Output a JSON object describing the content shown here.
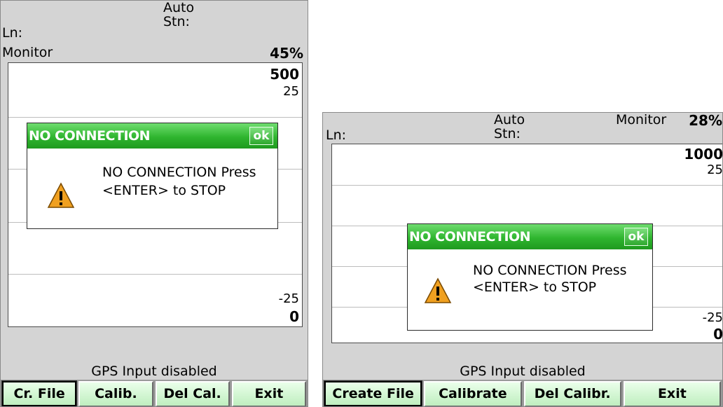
{
  "left_screen": {
    "header": {
      "mode": "Auto",
      "ln_label": "Ln:",
      "stn_label": "Stn:",
      "monitor_label": "Monitor",
      "percent": "45%"
    },
    "plot": {
      "top_scale": "500",
      "top_sub": "25",
      "bottom_sub": "-25",
      "bottom_scale": "0"
    },
    "dialog": {
      "title": "NO CONNECTION",
      "ok_label": "ok",
      "message_line1": "NO CONNECTION Press",
      "message_line2": "<ENTER> to STOP"
    },
    "status": "GPS  Input  disabled",
    "softkeys": [
      "Cr. File",
      "Calib.",
      "Del Cal.",
      "Exit"
    ]
  },
  "right_screen": {
    "header": {
      "mode": "Auto",
      "ln_label": "Ln:",
      "stn_label": "Stn:",
      "monitor_label": "Monitor",
      "percent": "28%"
    },
    "plot": {
      "top_scale": "1000",
      "top_sub": "25",
      "bottom_sub": "-25",
      "bottom_scale": "0"
    },
    "dialog": {
      "title": "NO CONNECTION",
      "ok_label": "ok",
      "message_line1": "NO CONNECTION Press",
      "message_line2": "<ENTER> to STOP"
    },
    "status": "GPS  Input  disabled",
    "softkeys": [
      "Create File",
      "Calibrate",
      "Del Calibr.",
      "Exit"
    ]
  },
  "colors": {
    "title_green": "#2fb52f",
    "softkey_bg": "#d6f5d6",
    "screen_bg": "#d4d4d4",
    "warning_orange": "#f0a020"
  },
  "icons": {
    "dialog_icon": "warning-triangle-icon"
  }
}
